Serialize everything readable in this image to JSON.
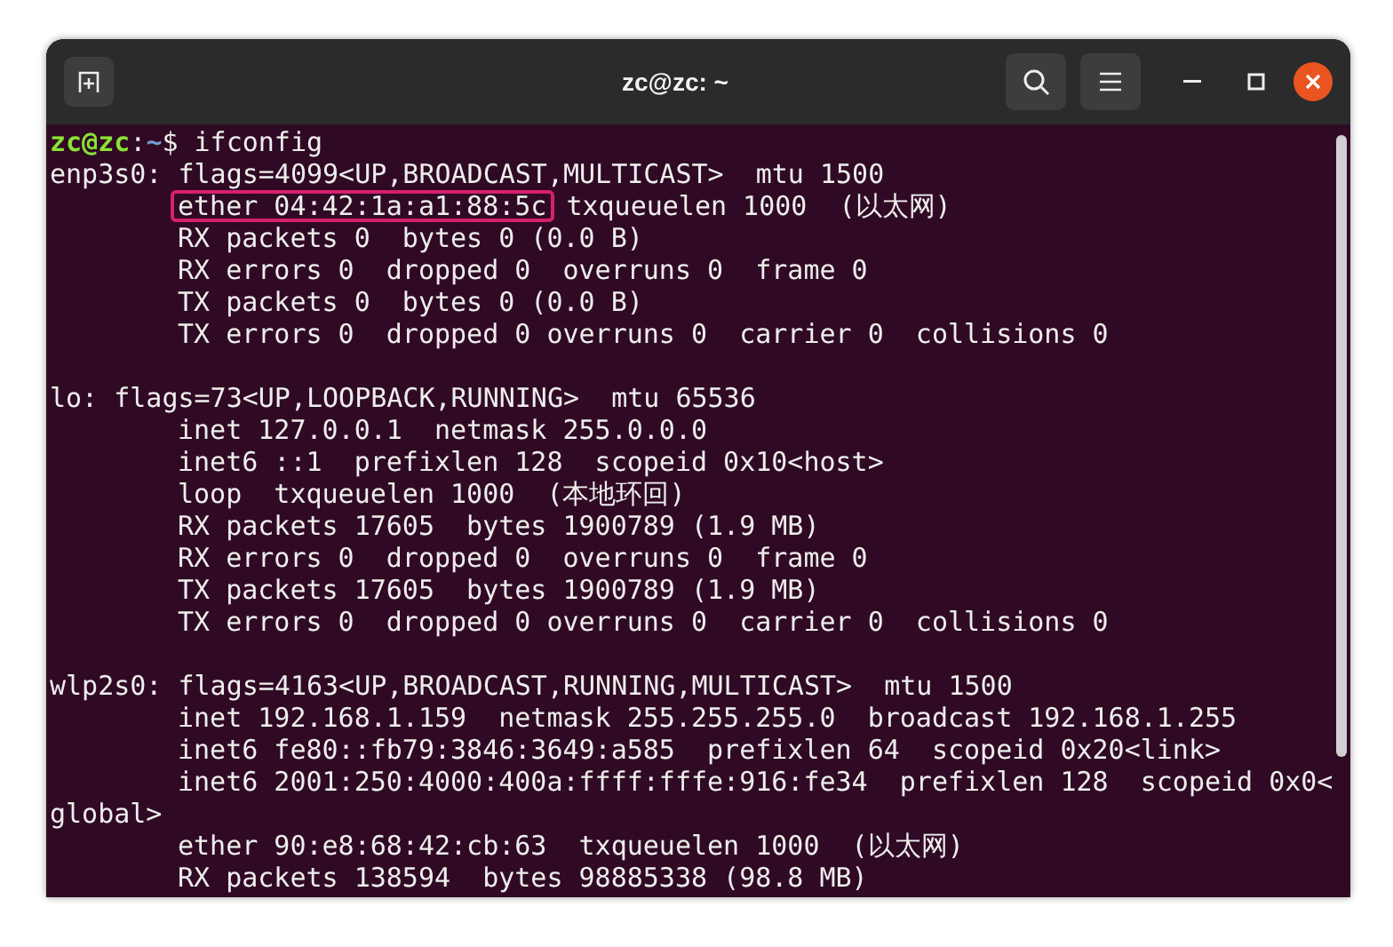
{
  "window": {
    "title": "zc@zc: ~"
  },
  "prompt": {
    "user": "zc@zc",
    "separator": ":",
    "path": "~",
    "command": "$ ifconfig"
  },
  "blocks": [
    {
      "header": "enp3s0: flags=4099<UP,BROADCAST,MULTICAST>  mtu 1500",
      "details": [
        {
          "kind": "highlighted",
          "highlight": "ether 04:42:1a:a1:88:5c",
          "text": "txqueuelen 1000  (以太网)"
        },
        {
          "kind": "indented",
          "text": "RX packets 0  bytes 0 (0.0 B)"
        },
        {
          "kind": "indented",
          "text": "RX errors 0  dropped 0  overruns 0  frame 0"
        },
        {
          "kind": "indented",
          "text": "TX packets 0  bytes 0 (0.0 B)"
        },
        {
          "kind": "indented",
          "text": "TX errors 0  dropped 0 overruns 0  carrier 0  collisions 0"
        }
      ]
    },
    {
      "header": "lo: flags=73<UP,LOOPBACK,RUNNING>  mtu 65536",
      "details": [
        {
          "kind": "indented",
          "text": "inet 127.0.0.1  netmask 255.0.0.0"
        },
        {
          "kind": "indented",
          "text": "inet6 ::1  prefixlen 128  scopeid 0x10<host>"
        },
        {
          "kind": "indented",
          "text": "loop  txqueuelen 1000  (本地环回)"
        },
        {
          "kind": "indented",
          "text": "RX packets 17605  bytes 1900789 (1.9 MB)"
        },
        {
          "kind": "indented",
          "text": "RX errors 0  dropped 0  overruns 0  frame 0"
        },
        {
          "kind": "indented",
          "text": "TX packets 17605  bytes 1900789 (1.9 MB)"
        },
        {
          "kind": "indented",
          "text": "TX errors 0  dropped 0 overruns 0  carrier 0  collisions 0"
        }
      ]
    },
    {
      "header": "wlp2s0: flags=4163<UP,BROADCAST,RUNNING,MULTICAST>  mtu 1500",
      "details": [
        {
          "kind": "indented",
          "text": "inet 192.168.1.159  netmask 255.255.255.0  broadcast 192.168.1.255"
        },
        {
          "kind": "indented",
          "text": "inet6 fe80::fb79:3846:3649:a585  prefixlen 64  scopeid 0x20<link>"
        },
        {
          "kind": "indented",
          "text": "inet6 2001:250:4000:400a:ffff:fffe:916:fe34  prefixlen 128  scopeid 0x0<"
        },
        {
          "kind": "wrapped",
          "text": "global>"
        },
        {
          "kind": "indented",
          "text": "ether 90:e8:68:42:cb:63  txqueuelen 1000  (以太网)"
        },
        {
          "kind": "indented",
          "text": "RX packets 138594  bytes 98885338 (98.8 MB)"
        }
      ]
    }
  ]
}
